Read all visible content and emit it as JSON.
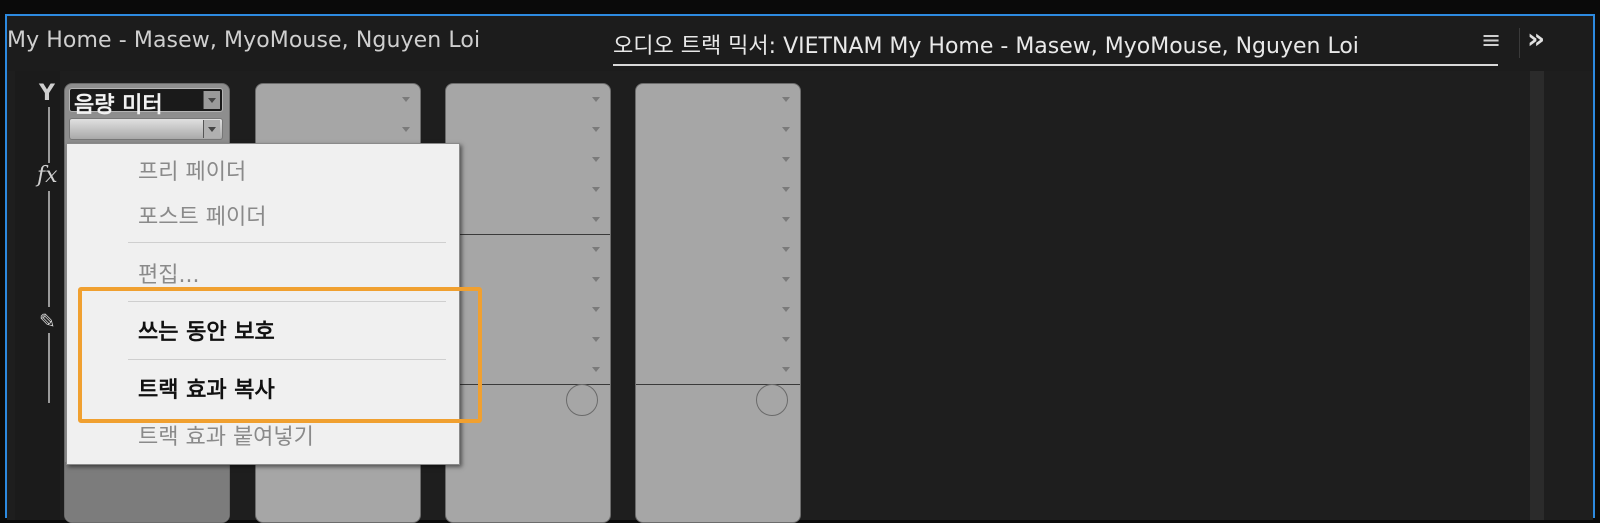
{
  "header": {
    "title_left": "My Home - Masew, MyoMouse, Nguyen Loi",
    "active_tab": "오디오 트랙 믹서: VIETNAM   My Home - Masew, MyoMouse, Nguyen Loi",
    "menu_icon": "≡",
    "overflow_icon": "»"
  },
  "left_strip": {
    "y_icon": "Y",
    "fx_icon": "fx",
    "pen_icon": "✎"
  },
  "channel1": {
    "meter_label": "음량 미터"
  },
  "context_menu": {
    "items": [
      {
        "label": "프리 페이더"
      },
      {
        "label": "포스트 페이더"
      },
      {
        "label": "편집..."
      },
      {
        "label": "쓰는 동안 보호"
      },
      {
        "label": "트랙 효과 복사"
      },
      {
        "label": "트랙 효과 붙여넣기"
      }
    ]
  },
  "colors": {
    "panel_border": "#2d8ae0",
    "highlight": "#f0a030"
  }
}
